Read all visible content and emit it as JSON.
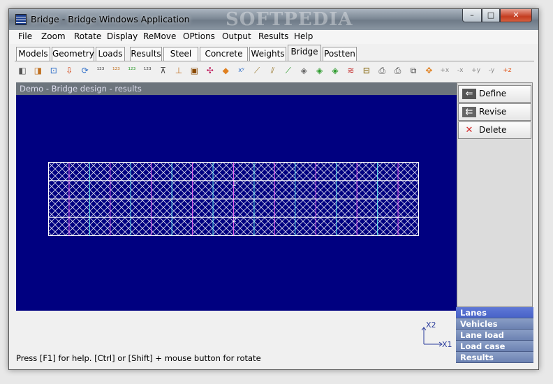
{
  "window": {
    "title": "Bridge - Bridge Windows Application",
    "watermark": "SOFTPEDIA",
    "controls": {
      "min": "–",
      "max": "□",
      "close": "✕"
    }
  },
  "menu": [
    "File",
    "Zoom",
    "Rotate",
    "Display",
    "ReMove",
    "OPtions",
    "Output",
    "Results",
    "Help"
  ],
  "tabs": [
    "Models",
    "Geometry",
    "Loads",
    "Results",
    "Steel",
    "Concrete",
    "Weights",
    "Bridge",
    "Postten"
  ],
  "active_tab": "Bridge",
  "toolbar_icons": [
    "cube-view-icon",
    "cube-solid-icon",
    "zoom-box-icon",
    "arrow-down-icon",
    "rotate-icon",
    "numbers-icon",
    "numbers-bar-icon",
    "numbers-green-icon",
    "numbers-support-icon",
    "truss-icon",
    "hinge-icon",
    "frame-icon",
    "nodes-icon",
    "box-icon",
    "xy-icon",
    "beam-icon",
    "beam-load-icon",
    "beam-green-icon",
    "plate-icon",
    "plate-green-icon",
    "plate-add-icon",
    "wave-icon",
    "spring-icon",
    "print-icon",
    "print-preview-icon",
    "copy-icon",
    "move-icon",
    "rotate-plus-x-icon",
    "rotate-minus-x-icon",
    "rotate-plus-y-icon",
    "rotate-minus-y-icon",
    "rotate-plus-z-icon"
  ],
  "toolbar_glyphs": [
    "◧",
    "◨",
    "⊡",
    "⇩",
    "⟳",
    "¹²³",
    "¹²³",
    "¹²³",
    "¹²³",
    "⊼",
    "⊥",
    "▣",
    "✣",
    "◆",
    "xʸ",
    "⟋",
    "⫽",
    "⟋",
    "◈",
    "◈",
    "◈",
    "≋",
    "⊟",
    "⎙",
    "⎙",
    "⧉",
    "✥",
    "+x",
    "-x",
    "+y",
    "-y",
    "+z"
  ],
  "document": {
    "title": "Demo - Bridge design - results"
  },
  "model_labels": {
    "lane1": "1",
    "lane2": "2"
  },
  "axes": {
    "x1": "X1",
    "x2": "X2"
  },
  "status": "Press [F1] for help. [Ctrl] or [Shift] + mouse button for rotate",
  "actions": [
    {
      "label": "Define",
      "icon": "arrow-left-icon",
      "glyph": "⇐"
    },
    {
      "label": "Revise",
      "icon": "revise-icon",
      "glyph": "⇇"
    },
    {
      "label": "Delete",
      "icon": "delete-icon",
      "glyph": "✕"
    }
  ],
  "side_nav": [
    "Lanes",
    "Vehicles",
    "Lane load",
    "Load case",
    "Results"
  ],
  "side_nav_active": "Lanes",
  "colors": {
    "canvas": "#000080",
    "mesh": "#ffffff",
    "accent_lines": "#ff66ff",
    "cyan_lines": "#66ffff",
    "delete": "#d02020"
  }
}
